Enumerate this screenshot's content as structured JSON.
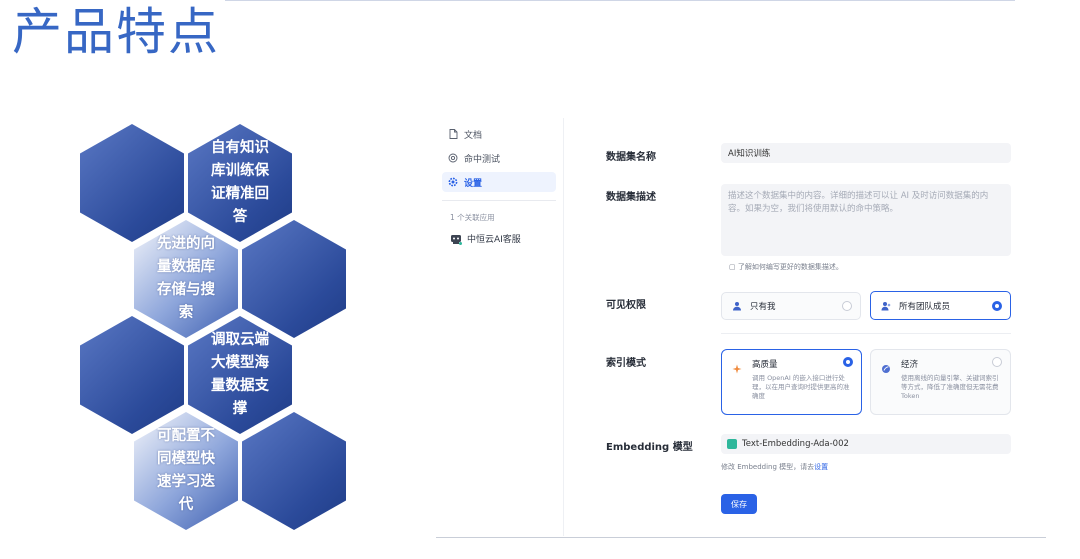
{
  "slide": {
    "title": "产品特点"
  },
  "hexagons": [
    {
      "label": "自有知识库训练保证精准回答"
    },
    {
      "label": "先进的向量数据库存储与搜索"
    },
    {
      "label": "调取云端大模型海量数据支撑"
    },
    {
      "label": "可配置不同模型快速学习迭代"
    }
  ],
  "sidebar": {
    "items": [
      {
        "label": "文档",
        "icon": "document-icon"
      },
      {
        "label": "命中测试",
        "icon": "target-icon"
      },
      {
        "label": "设置",
        "icon": "gear-icon",
        "active": true
      }
    ],
    "related_count": "1 个关联应用",
    "related_app": "中恒云AI客服"
  },
  "form": {
    "dataset_name_label": "数据集名称",
    "dataset_name_value": "AI知识训练",
    "dataset_desc_label": "数据集描述",
    "dataset_desc_placeholder": "描述这个数据集中的内容。详细的描述可以让 AI 及时访问数据集的内容。如果为空，我们将使用默认的命中策略。",
    "dataset_desc_hint": "了解如何编写更好的数据集描述。",
    "visibility_label": "可见权限",
    "visibility_options": [
      {
        "label": "只有我",
        "selected": false
      },
      {
        "label": "所有团队成员",
        "selected": true
      }
    ],
    "index_mode_label": "索引模式",
    "index_modes": [
      {
        "title": "高质量",
        "desc": "调用 OpenAI 的嵌入接口进行处理，以在用户查询时提供更高的准确度",
        "selected": true
      },
      {
        "title": "经济",
        "desc": "使用离线的向量引擎、关键词索引等方式，降低了准确度但无需花费 Token",
        "selected": false
      }
    ],
    "embedding_label": "Embedding 模型",
    "embedding_value": "Text-Embedding-Ada-002",
    "embedding_hint_prefix": "修改 Embedding 模型，请去",
    "embedding_hint_link": "设置",
    "save_label": "保存"
  },
  "colors": {
    "accent": "#2a62e6",
    "title": "#3767c4",
    "hex_dark": "#2b4a9a"
  }
}
